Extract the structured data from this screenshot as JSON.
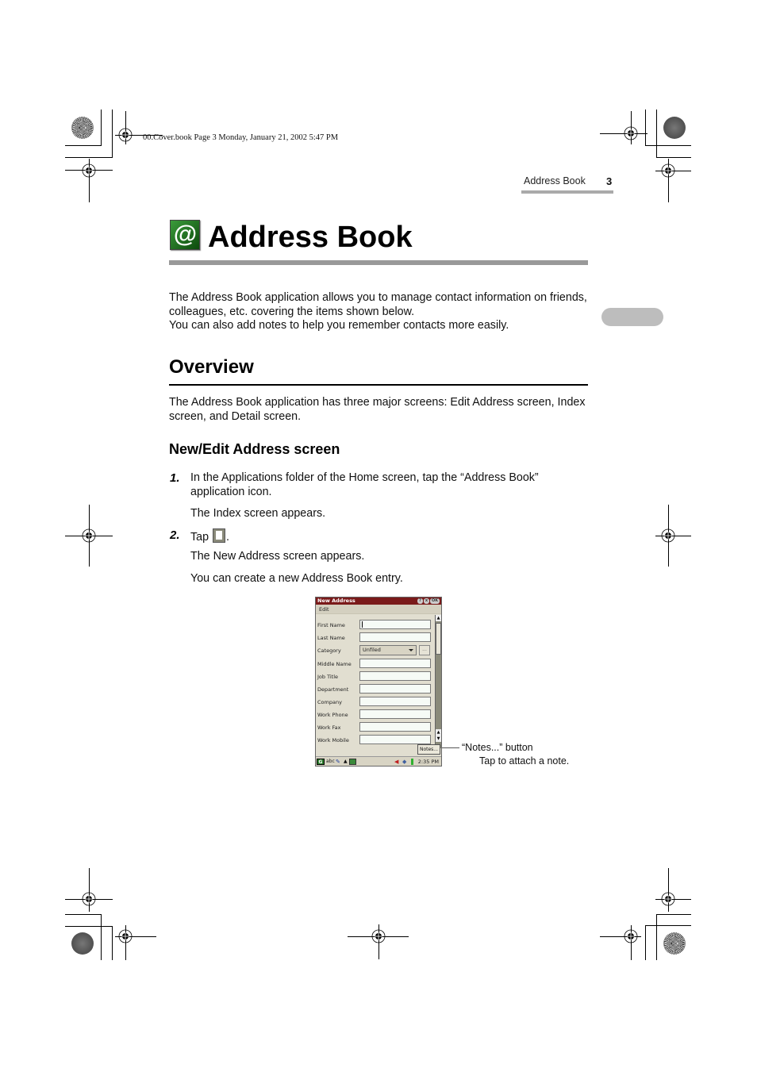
{
  "slug": "00.Cover.book  Page 3  Monday, January 21, 2002  5:47 PM",
  "running_head": {
    "section": "Address Book",
    "page_number": "3"
  },
  "chapter": {
    "icon": "address-book-at-icon",
    "icon_glyph": "@",
    "title": "Address Book"
  },
  "intro": [
    "The Address Book application allows you to manage contact information on friends,",
    "colleagues, etc. covering the items shown below.",
    "You can also add notes to help you remember contacts more easily."
  ],
  "overview": {
    "heading": "Overview",
    "text_lines": [
      "The Address Book application has three major screens: Edit Address screen, Index",
      "screen, and Detail screen."
    ]
  },
  "subsection": {
    "heading": "New/Edit Address screen"
  },
  "steps": [
    {
      "number": "1.",
      "lines": [
        "In the Applications folder of the Home screen, tap the “Address Book”",
        "application icon."
      ],
      "results": [
        "The Index screen appears."
      ]
    },
    {
      "number": "2.",
      "prefix": "Tap",
      "icon": "new-document-icon",
      "suffix": ".",
      "results": [
        "The New Address screen appears.",
        "You can create a new Address Book entry."
      ]
    }
  ],
  "device": {
    "title": "New Address",
    "title_buttons": [
      "?",
      "x",
      "OK"
    ],
    "menu": "Edit",
    "fields": [
      {
        "label": "First Name",
        "type": "text",
        "value": ""
      },
      {
        "label": "Last Name",
        "type": "text",
        "value": ""
      },
      {
        "label": "Category",
        "type": "select",
        "value": "Unfiled",
        "extra_button": "..."
      },
      {
        "label": "Middle Name",
        "type": "text",
        "value": ""
      },
      {
        "label": "Job Title",
        "type": "text",
        "value": ""
      },
      {
        "label": "Department",
        "type": "text",
        "value": ""
      },
      {
        "label": "Company",
        "type": "text",
        "value": ""
      },
      {
        "label": "Work Phone",
        "type": "text",
        "value": ""
      },
      {
        "label": "Work Fax",
        "type": "text",
        "value": ""
      },
      {
        "label": "Work Mobile",
        "type": "text",
        "value": ""
      }
    ],
    "notes_button": "Notes...",
    "taskbar": {
      "input_mode": "abc",
      "clock": "2:35 PM"
    }
  },
  "callout": {
    "title": "“Notes...” button",
    "description": "Tap to attach a note."
  },
  "colors": {
    "title_bar": "#7a1a1a",
    "device_bg": "#e1ded0",
    "rule_gray": "#999999",
    "tab_pill": "#bdbdbd"
  }
}
